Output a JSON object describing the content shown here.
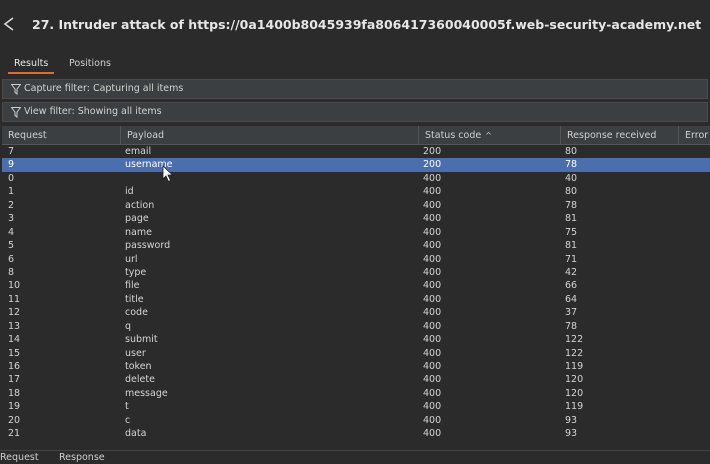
{
  "window": {
    "title": "27. Intruder attack of https://0a1400b8045939fa806417360040005f.web-security-academy.net"
  },
  "tabs": [
    {
      "label": "Results"
    },
    {
      "label": "Positions"
    }
  ],
  "filters": {
    "capture": "Capture filter: Capturing all items",
    "view": "View filter: Showing all items"
  },
  "table": {
    "columns": [
      "Request",
      "Payload",
      "Status code",
      "Response received",
      "Error"
    ],
    "sort_indicator": "^",
    "rows": [
      [
        "7",
        "email",
        "200",
        "80",
        ""
      ],
      [
        "9",
        "username",
        "200",
        "78",
        ""
      ],
      [
        "0",
        "",
        "400",
        "40",
        ""
      ],
      [
        "1",
        "id",
        "400",
        "80",
        ""
      ],
      [
        "2",
        "action",
        "400",
        "78",
        ""
      ],
      [
        "3",
        "page",
        "400",
        "81",
        ""
      ],
      [
        "4",
        "name",
        "400",
        "75",
        ""
      ],
      [
        "5",
        "password",
        "400",
        "81",
        ""
      ],
      [
        "6",
        "url",
        "400",
        "71",
        ""
      ],
      [
        "8",
        "type",
        "400",
        "42",
        ""
      ],
      [
        "10",
        "file",
        "400",
        "66",
        ""
      ],
      [
        "11",
        "title",
        "400",
        "64",
        ""
      ],
      [
        "12",
        "code",
        "400",
        "37",
        ""
      ],
      [
        "13",
        "q",
        "400",
        "78",
        ""
      ],
      [
        "14",
        "submit",
        "400",
        "122",
        ""
      ],
      [
        "15",
        "user",
        "400",
        "122",
        ""
      ],
      [
        "16",
        "token",
        "400",
        "119",
        ""
      ],
      [
        "17",
        "delete",
        "400",
        "120",
        ""
      ],
      [
        "18",
        "message",
        "400",
        "120",
        ""
      ],
      [
        "19",
        "t",
        "400",
        "119",
        ""
      ],
      [
        "20",
        "c",
        "400",
        "93",
        ""
      ],
      [
        "21",
        "data",
        "400",
        "93",
        ""
      ]
    ],
    "selected_row": 1
  },
  "bottom_tabs": [
    {
      "label": "Request"
    },
    {
      "label": "Response"
    }
  ],
  "colors": {
    "accent": "#e06b33",
    "selection": "#4b6eaf",
    "background": "#2b2b2b"
  }
}
